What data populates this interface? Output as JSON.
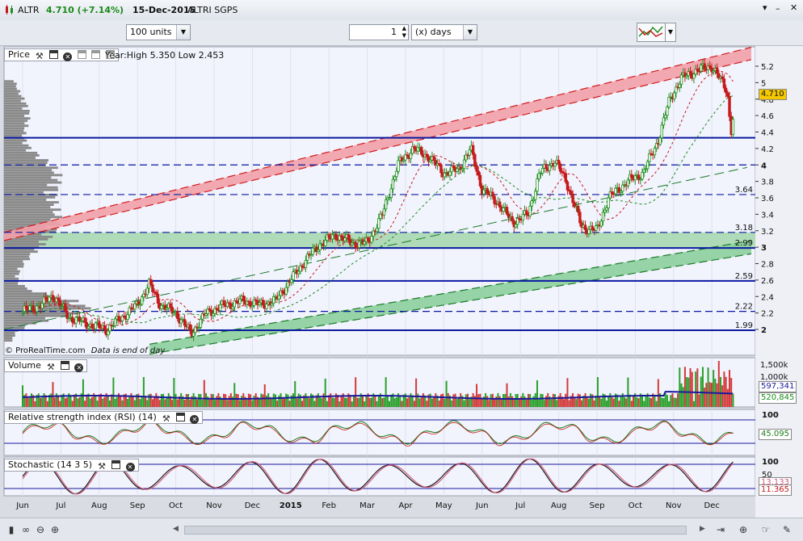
{
  "header": {
    "symbol": "ALTR",
    "price_change": "4.710 (+7.14%)",
    "date": "15-Dec-2015",
    "instrument_name": "ALTRI SGPS",
    "price_change_color": "#1a8a1a"
  },
  "toolbar": {
    "units_value": "100 units",
    "period_value": "1",
    "period_unit": "(x) days"
  },
  "price_panel": {
    "title": "Price",
    "year_range": "Year:High 5.350 Low 2.453",
    "watermark": "© ProRealTime.com",
    "end_note": "Data is end of day",
    "level_labels": [
      "3.64",
      "3.18",
      "2.99",
      "2.59",
      "2.22",
      "1.99"
    ],
    "last_price": "4.710"
  },
  "volume_panel": {
    "title": "Volume",
    "axis_labels": [
      "1,500k",
      "1,000k"
    ],
    "value_ma": "597,341",
    "value_vol": "520,845"
  },
  "rsi_panel": {
    "title": "Relative strength index (RSI) (14)",
    "axis_label": "100",
    "value": "45.095"
  },
  "stoch_panel": {
    "title": "Stochastic (14 3 5)",
    "axis_label_top": "100",
    "axis_label_mid": "50",
    "value_d": "13.133",
    "value_k": "11.365"
  },
  "x_axis": {
    "months": [
      "Jun",
      "Jul",
      "Aug",
      "Sep",
      "Oct",
      "Nov",
      "Dec",
      "2015",
      "Feb",
      "Mar",
      "Apr",
      "May",
      "Jun",
      "Jul",
      "Aug",
      "Sep",
      "Oct",
      "Nov",
      "Dec"
    ]
  },
  "colors": {
    "candle_up": "#1f8f1f",
    "candle_down": "#c41a1a",
    "level_line": "#0a1aa0",
    "red_channel": "#f2a0a8",
    "green_channel": "#8ccf9c",
    "support_zone": "#a8d8b0",
    "volume_ma": "#1a1a9a",
    "rsi_line": "#1a7a1a",
    "stoch_k": "#1a1a1a",
    "stoch_d": "#d06080"
  },
  "chart_data": {
    "type": "candlestick",
    "title": "ALTR",
    "y_range": [
      1.75,
      5.4
    ],
    "price_ticks": [
      2,
      2.2,
      2.4,
      2.6,
      2.8,
      3,
      3.2,
      3.4,
      3.6,
      3.8,
      4,
      4.2,
      4.4,
      4.6,
      4.8,
      5,
      5.2
    ],
    "horizontal_levels": [
      {
        "value": 4.33,
        "style": "solid"
      },
      {
        "value": 4.0,
        "style": "dashed"
      },
      {
        "value": 3.64,
        "style": "dashed"
      },
      {
        "value": 3.18,
        "style": "dashed"
      },
      {
        "value": 2.99,
        "style": "solid"
      },
      {
        "value": 2.59,
        "style": "solid"
      },
      {
        "value": 2.22,
        "style": "dashed"
      },
      {
        "value": 1.99,
        "style": "solid"
      }
    ],
    "support_zone": [
      2.99,
      3.18
    ],
    "price_path": [
      {
        "m": 0.0,
        "p": 2.22
      },
      {
        "m": 0.5,
        "p": 2.3
      },
      {
        "m": 0.8,
        "p": 2.42
      },
      {
        "m": 1.2,
        "p": 2.15
      },
      {
        "m": 1.8,
        "p": 2.05
      },
      {
        "m": 2.2,
        "p": 2.0
      },
      {
        "m": 2.6,
        "p": 2.15
      },
      {
        "m": 3.0,
        "p": 2.3
      },
      {
        "m": 3.3,
        "p": 2.55
      },
      {
        "m": 3.6,
        "p": 2.3
      },
      {
        "m": 4.0,
        "p": 2.2
      },
      {
        "m": 4.4,
        "p": 1.95
      },
      {
        "m": 4.8,
        "p": 2.2
      },
      {
        "m": 5.3,
        "p": 2.3
      },
      {
        "m": 5.8,
        "p": 2.35
      },
      {
        "m": 6.2,
        "p": 2.3
      },
      {
        "m": 6.6,
        "p": 2.35
      },
      {
        "m": 7.0,
        "p": 2.6
      },
      {
        "m": 7.4,
        "p": 2.85
      },
      {
        "m": 7.8,
        "p": 3.05
      },
      {
        "m": 8.2,
        "p": 3.15
      },
      {
        "m": 8.6,
        "p": 3.05
      },
      {
        "m": 9.0,
        "p": 3.05
      },
      {
        "m": 9.4,
        "p": 3.4
      },
      {
        "m": 9.8,
        "p": 4.0
      },
      {
        "m": 10.2,
        "p": 4.2
      },
      {
        "m": 10.6,
        "p": 4.1
      },
      {
        "m": 11.0,
        "p": 3.9
      },
      {
        "m": 11.4,
        "p": 3.95
      },
      {
        "m": 11.7,
        "p": 4.2
      },
      {
        "m": 12.0,
        "p": 3.7
      },
      {
        "m": 12.4,
        "p": 3.55
      },
      {
        "m": 12.8,
        "p": 3.3
      },
      {
        "m": 13.2,
        "p": 3.4
      },
      {
        "m": 13.5,
        "p": 3.9
      },
      {
        "m": 13.9,
        "p": 4.05
      },
      {
        "m": 14.2,
        "p": 3.8
      },
      {
        "m": 14.6,
        "p": 3.25
      },
      {
        "m": 15.0,
        "p": 3.2
      },
      {
        "m": 15.3,
        "p": 3.6
      },
      {
        "m": 15.8,
        "p": 3.8
      },
      {
        "m": 16.2,
        "p": 3.9
      },
      {
        "m": 16.6,
        "p": 4.3
      },
      {
        "m": 16.9,
        "p": 4.8
      },
      {
        "m": 17.2,
        "p": 5.05
      },
      {
        "m": 17.6,
        "p": 5.15
      },
      {
        "m": 18.0,
        "p": 5.2
      },
      {
        "m": 18.4,
        "p": 4.9
      },
      {
        "m": 18.5,
        "p": 4.4
      },
      {
        "m": 18.6,
        "p": 4.71
      }
    ]
  }
}
